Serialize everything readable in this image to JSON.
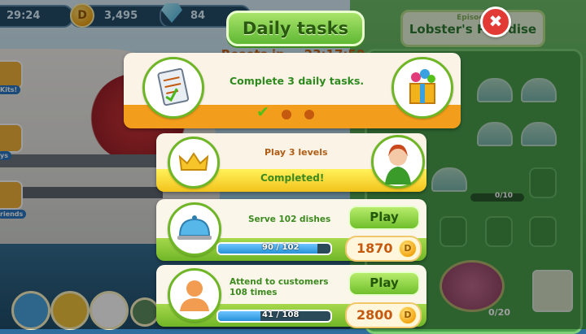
{
  "hud": {
    "time": "29:24",
    "coin_symbol": "D",
    "coins": "3,495",
    "gems": "84"
  },
  "side": {
    "item1": "Kits!",
    "item2": "ys",
    "item3": "riends"
  },
  "episode": {
    "label": "Episode",
    "title": "Lobster's Paradise",
    "progress": "0/10",
    "bottom_progress": "0/20"
  },
  "dialog": {
    "title": "Daily tasks",
    "reset_label": "Resets in",
    "reset_time": "23:17:50",
    "main_text": "Complete 3 daily tasks.",
    "main_progress_done": 1,
    "main_progress_total": 3,
    "check_mark": "✔"
  },
  "tasks": [
    {
      "title": "Play 3 levels",
      "status": "Completed!"
    },
    {
      "title": "Serve 102 dishes",
      "button": "Play",
      "progress_text": "90 / 102",
      "progress_fraction": 0.882,
      "reward": "1870",
      "reward_symbol": "D"
    },
    {
      "title": "Attend to customers 108 times",
      "button": "Play",
      "progress_text": "41 / 108",
      "progress_fraction": 0.38,
      "reward": "2800",
      "reward_symbol": "D"
    }
  ],
  "close_symbol": "✖",
  "colors": {
    "green": "#6fb626",
    "orange": "#f29e1c",
    "text_brown": "#7a3d0e"
  }
}
